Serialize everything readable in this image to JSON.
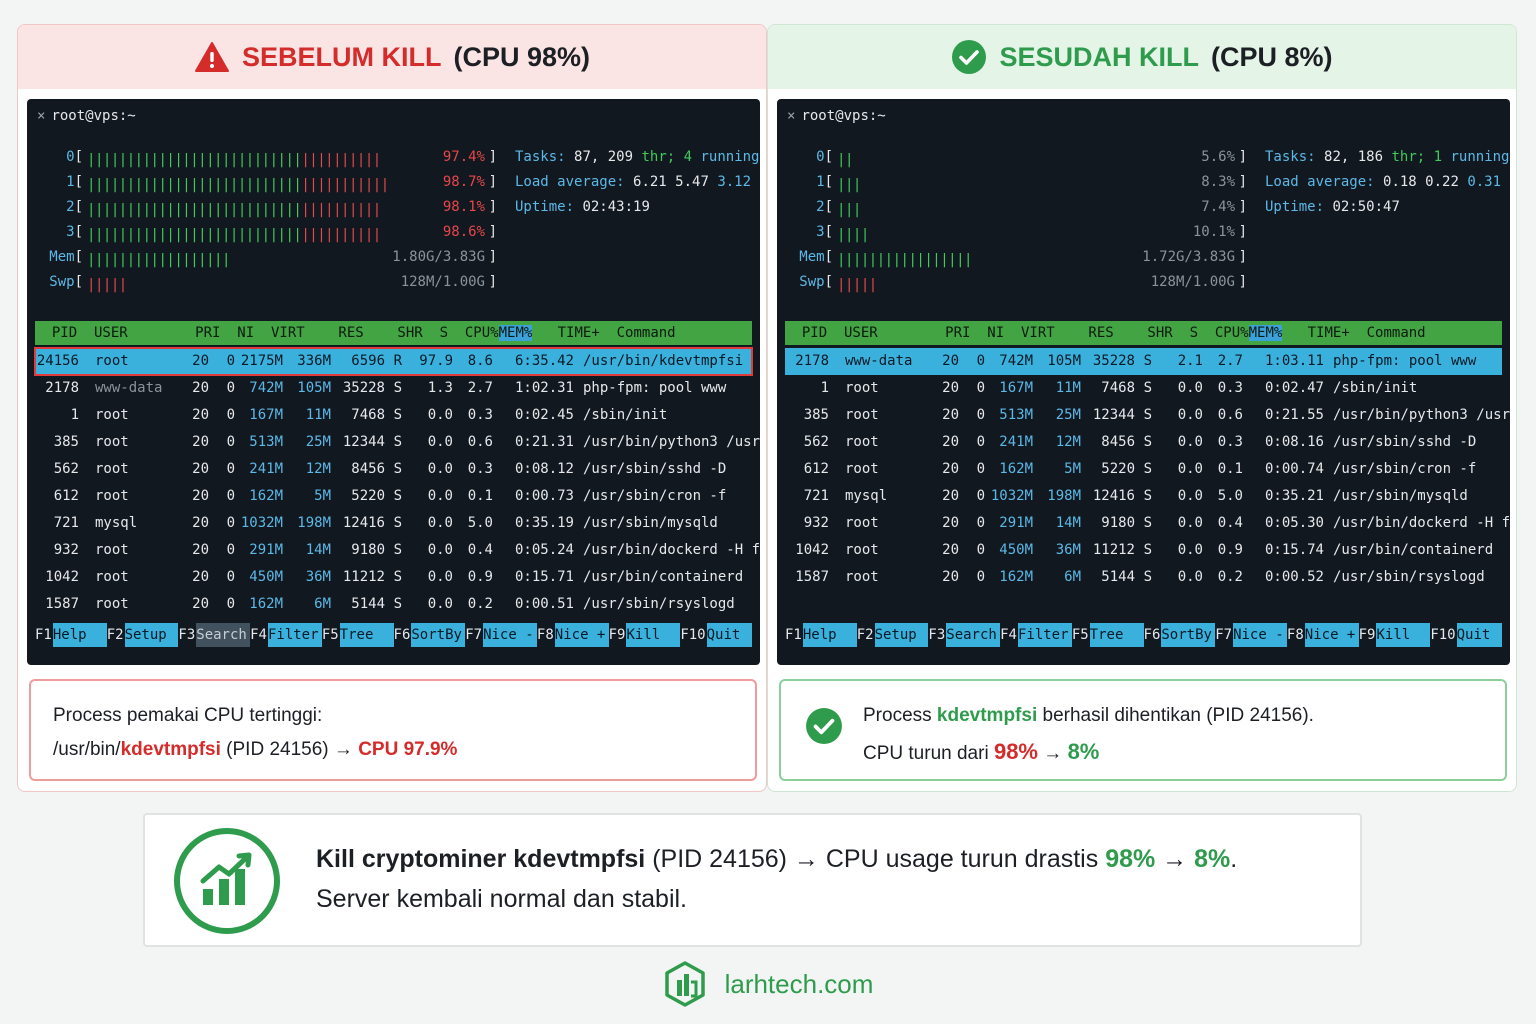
{
  "colors": {
    "red": "#d42b2b",
    "green": "#2e9b4d",
    "terminal_bg": "#121820",
    "select_cyan": "#3ab0dd",
    "header_green": "#43a443"
  },
  "before": {
    "title_strong": "SEBELUM KILL",
    "title_rest": "(CPU 98%)",
    "icon": "warning-triangle-icon",
    "terminal": {
      "titlebar": "root@vps:~",
      "meters": [
        {
          "label": "0",
          "value": "97.4%",
          "fill": 0.974,
          "hot": true
        },
        {
          "label": "1",
          "value": "98.7%",
          "fill": 0.987,
          "hot": true
        },
        {
          "label": "2",
          "value": "98.1%",
          "fill": 0.981,
          "hot": true
        },
        {
          "label": "3",
          "value": "98.6%",
          "fill": 0.986,
          "hot": true
        },
        {
          "label": "Mem",
          "value": "1.80G/3.83G",
          "fill": 0.47,
          "hot": false
        },
        {
          "label": "Swp",
          "value": "128M/1.00G",
          "fill": 0.13,
          "hot": false
        }
      ],
      "tasks": {
        "label": "Tasks:",
        "count": "87,",
        "threads": "209",
        "thr_label": "thr;",
        "running": "4",
        "running_label": "running"
      },
      "load": {
        "label": "Load average:",
        "v1": "6.21",
        "v2": "5.47",
        "v3": "3.12"
      },
      "uptime": {
        "label": "Uptime:",
        "value": "02:43:19"
      },
      "header": "  PID  USER        PRI  NI  VIRT    RES    SHR  S  CPU%",
      "header_mem": "MEM%",
      "header_rest": "   TIME+  Command",
      "processes": [
        {
          "pid": "24156",
          "user": "root",
          "pri": "20",
          "ni": "0",
          "virt": "2175M",
          "res": "336M",
          "shr": "6596",
          "s": "R",
          "cpu": "97.9",
          "mem": "8.6",
          "time": "6:35.42",
          "cmd": "/usr/bin/kdevtmpfsi"
        },
        {
          "pid": "2178",
          "user": "www-data",
          "pri": "20",
          "ni": "0",
          "virt": "742M",
          "res": "105M",
          "shr": "35228",
          "s": "S",
          "cpu": "1.3",
          "mem": "2.7",
          "time": "1:02.31",
          "cmd": "php-fpm: pool www"
        },
        {
          "pid": "1",
          "user": "root",
          "pri": "20",
          "ni": "0",
          "virt": "167M",
          "res": "11M",
          "shr": "7468",
          "s": "S",
          "cpu": "0.0",
          "mem": "0.3",
          "time": "0:02.45",
          "cmd": "/sbin/init"
        },
        {
          "pid": "385",
          "user": "root",
          "pri": "20",
          "ni": "0",
          "virt": "513M",
          "res": "25M",
          "shr": "12344",
          "s": "S",
          "cpu": "0.0",
          "mem": "0.6",
          "time": "0:21.31",
          "cmd": "/usr/bin/python3 /usr"
        },
        {
          "pid": "562",
          "user": "root",
          "pri": "20",
          "ni": "0",
          "virt": "241M",
          "res": "12M",
          "shr": "8456",
          "s": "S",
          "cpu": "0.0",
          "mem": "0.3",
          "time": "0:08.12",
          "cmd": "/usr/sbin/sshd -D"
        },
        {
          "pid": "612",
          "user": "root",
          "pri": "20",
          "ni": "0",
          "virt": "162M",
          "res": "5M",
          "shr": "5220",
          "s": "S",
          "cpu": "0.0",
          "mem": "0.1",
          "time": "0:00.73",
          "cmd": "/usr/sbin/cron -f"
        },
        {
          "pid": "721",
          "user": "mysql",
          "pri": "20",
          "ni": "0",
          "virt": "1032M",
          "res": "198M",
          "shr": "12416",
          "s": "S",
          "cpu": "0.0",
          "mem": "5.0",
          "time": "0:35.19",
          "cmd": "/usr/sbin/mysqld"
        },
        {
          "pid": "932",
          "user": "root",
          "pri": "20",
          "ni": "0",
          "virt": "291M",
          "res": "14M",
          "shr": "9180",
          "s": "S",
          "cpu": "0.0",
          "mem": "0.4",
          "time": "0:05.24",
          "cmd": "/usr/bin/dockerd -H f"
        },
        {
          "pid": "1042",
          "user": "root",
          "pri": "20",
          "ni": "0",
          "virt": "450M",
          "res": "36M",
          "shr": "11212",
          "s": "S",
          "cpu": "0.0",
          "mem": "0.9",
          "time": "0:15.71",
          "cmd": "/usr/bin/containerd"
        },
        {
          "pid": "1587",
          "user": "root",
          "pri": "20",
          "ni": "0",
          "virt": "162M",
          "res": "6M",
          "shr": "5144",
          "s": "S",
          "cpu": "0.0",
          "mem": "0.2",
          "time": "0:00.51",
          "cmd": "/usr/sbin/rsyslogd"
        }
      ]
    },
    "note": {
      "line1": "Process pemakai CPU tertinggi:",
      "path_prefix": "/usr/bin/",
      "proc": "kdevtmpfsi",
      "pid_text": " (PID 24156) → ",
      "cpu_text": "CPU 97.9%"
    }
  },
  "after": {
    "title_strong": "SESUDAH KILL",
    "title_rest": "(CPU 8%)",
    "icon": "check-circle-icon",
    "terminal": {
      "titlebar": "root@vps:~",
      "meters": [
        {
          "label": "0",
          "value": "5.6%",
          "fill": 0.056,
          "hot": false
        },
        {
          "label": "1",
          "value": "8.3%",
          "fill": 0.083,
          "hot": false
        },
        {
          "label": "2",
          "value": "7.4%",
          "fill": 0.074,
          "hot": false
        },
        {
          "label": "3",
          "value": "10.1%",
          "fill": 0.101,
          "hot": false
        },
        {
          "label": "Mem",
          "value": "1.72G/3.83G",
          "fill": 0.45,
          "hot": false
        },
        {
          "label": "Swp",
          "value": "128M/1.00G",
          "fill": 0.13,
          "hot": false
        }
      ],
      "tasks": {
        "label": "Tasks:",
        "count": "82,",
        "threads": "186",
        "thr_label": "thr;",
        "running": "1",
        "running_label": "running"
      },
      "load": {
        "label": "Load average:",
        "v1": "0.18",
        "v2": "0.22",
        "v3": "0.31"
      },
      "uptime": {
        "label": "Uptime:",
        "value": "02:50:47"
      },
      "header": "  PID  USER        PRI  NI  VIRT    RES    SHR  S  CPU%",
      "header_mem": "MEM%",
      "header_rest": "   TIME+  Command",
      "processes": [
        {
          "pid": "2178",
          "user": "www-data",
          "pri": "20",
          "ni": "0",
          "virt": "742M",
          "res": "105M",
          "shr": "35228",
          "s": "S",
          "cpu": "2.1",
          "mem": "2.7",
          "time": "1:03.11",
          "cmd": "php-fpm: pool www"
        },
        {
          "pid": "1",
          "user": "root",
          "pri": "20",
          "ni": "0",
          "virt": "167M",
          "res": "11M",
          "shr": "7468",
          "s": "S",
          "cpu": "0.0",
          "mem": "0.3",
          "time": "0:02.47",
          "cmd": "/sbin/init"
        },
        {
          "pid": "385",
          "user": "root",
          "pri": "20",
          "ni": "0",
          "virt": "513M",
          "res": "25M",
          "shr": "12344",
          "s": "S",
          "cpu": "0.0",
          "mem": "0.6",
          "time": "0:21.55",
          "cmd": "/usr/bin/python3 /usr"
        },
        {
          "pid": "562",
          "user": "root",
          "pri": "20",
          "ni": "0",
          "virt": "241M",
          "res": "12M",
          "shr": "8456",
          "s": "S",
          "cpu": "0.0",
          "mem": "0.3",
          "time": "0:08.16",
          "cmd": "/usr/sbin/sshd -D"
        },
        {
          "pid": "612",
          "user": "root",
          "pri": "20",
          "ni": "0",
          "virt": "162M",
          "res": "5M",
          "shr": "5220",
          "s": "S",
          "cpu": "0.0",
          "mem": "0.1",
          "time": "0:00.74",
          "cmd": "/usr/sbin/cron -f"
        },
        {
          "pid": "721",
          "user": "mysql",
          "pri": "20",
          "ni": "0",
          "virt": "1032M",
          "res": "198M",
          "shr": "12416",
          "s": "S",
          "cpu": "0.0",
          "mem": "5.0",
          "time": "0:35.21",
          "cmd": "/usr/sbin/mysqld"
        },
        {
          "pid": "932",
          "user": "root",
          "pri": "20",
          "ni": "0",
          "virt": "291M",
          "res": "14M",
          "shr": "9180",
          "s": "S",
          "cpu": "0.0",
          "mem": "0.4",
          "time": "0:05.30",
          "cmd": "/usr/bin/dockerd -H f"
        },
        {
          "pid": "1042",
          "user": "root",
          "pri": "20",
          "ni": "0",
          "virt": "450M",
          "res": "36M",
          "shr": "11212",
          "s": "S",
          "cpu": "0.0",
          "mem": "0.9",
          "time": "0:15.74",
          "cmd": "/usr/bin/containerd"
        },
        {
          "pid": "1587",
          "user": "root",
          "pri": "20",
          "ni": "0",
          "virt": "162M",
          "res": "6M",
          "shr": "5144",
          "s": "S",
          "cpu": "0.0",
          "mem": "0.2",
          "time": "0:00.52",
          "cmd": "/usr/sbin/rsyslogd"
        }
      ]
    },
    "note": {
      "line1_a": "Process ",
      "proc": "kdevtmpfsi",
      "line1_b": " berhasil dihentikan (PID 24156).",
      "line2_a": "CPU turun dari ",
      "from": "98%",
      "arrow": " → ",
      "to": "8%"
    }
  },
  "fkeys": [
    {
      "key": "F1",
      "label": "Help"
    },
    {
      "key": "F2",
      "label": "Setup"
    },
    {
      "key": "F3",
      "label": "Search"
    },
    {
      "key": "F4",
      "label": "Filter"
    },
    {
      "key": "F5",
      "label": "Tree"
    },
    {
      "key": "F6",
      "label": "SortBy"
    },
    {
      "key": "F7",
      "label": "Nice -"
    },
    {
      "key": "F8",
      "label": "Nice +"
    },
    {
      "key": "F9",
      "label": "Kill"
    },
    {
      "key": "F10",
      "label": "Quit"
    }
  ],
  "summary": {
    "icon": "chart-growth-icon",
    "bold": "Kill cryptominer kdevtmpfsi",
    "mid": " (PID 24156) → CPU usage turun drastis ",
    "from": "98%",
    "arrow": " → ",
    "to": "8%",
    "end": ".",
    "line2": "Server kembali normal dan stabil."
  },
  "brand": {
    "icon": "larhtech-logo-icon",
    "text": "larhtech.com"
  }
}
